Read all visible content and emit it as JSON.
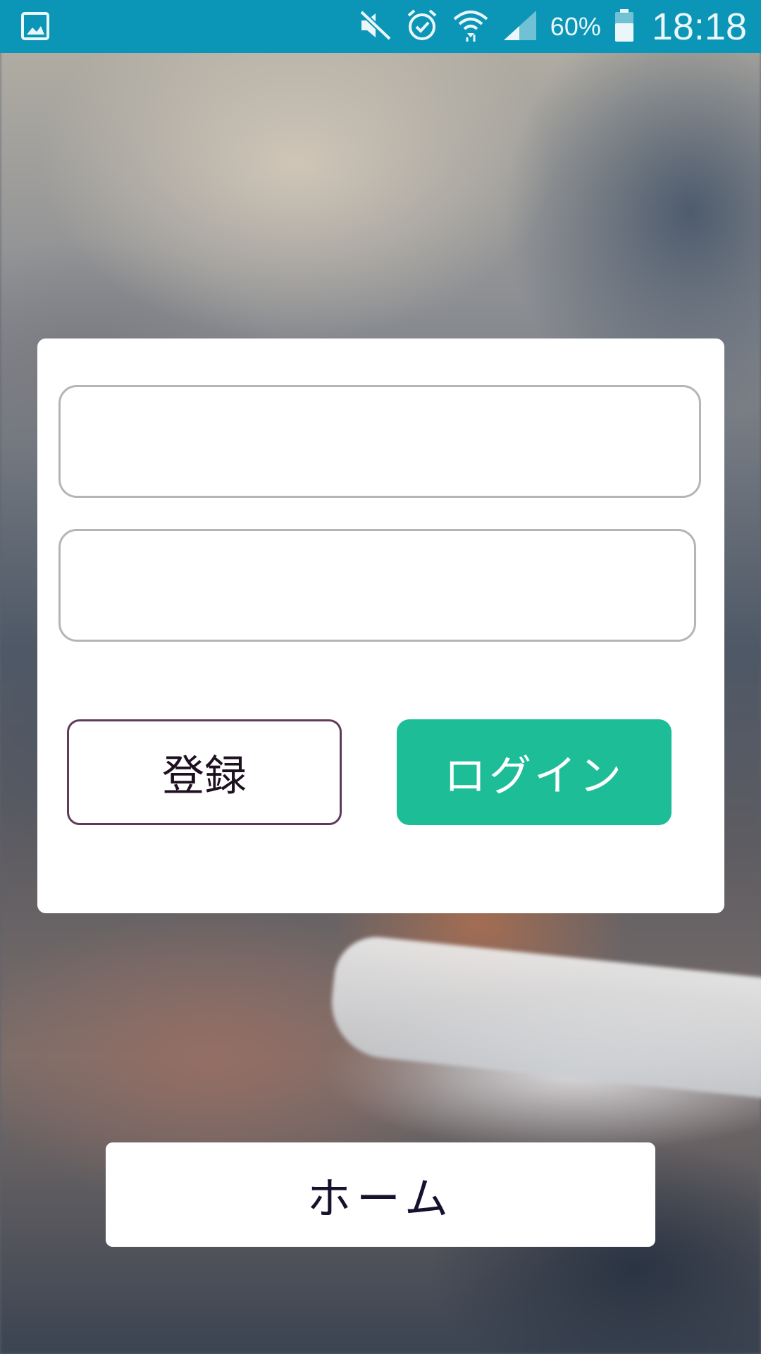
{
  "status_bar": {
    "battery_percent": "60%",
    "time": "18:18",
    "color": "#0b96b7",
    "icons": [
      "gallery-icon",
      "mute-icon",
      "alarm-icon",
      "wifi-icon",
      "signal-icon",
      "battery-icon"
    ]
  },
  "login_form": {
    "username_value": "",
    "password_value": "",
    "register_label": "登録",
    "login_label": "ログイン",
    "login_color": "#1dbd98",
    "register_border_color": "#5f3b5a"
  },
  "home_button": {
    "label": "ホーム"
  }
}
